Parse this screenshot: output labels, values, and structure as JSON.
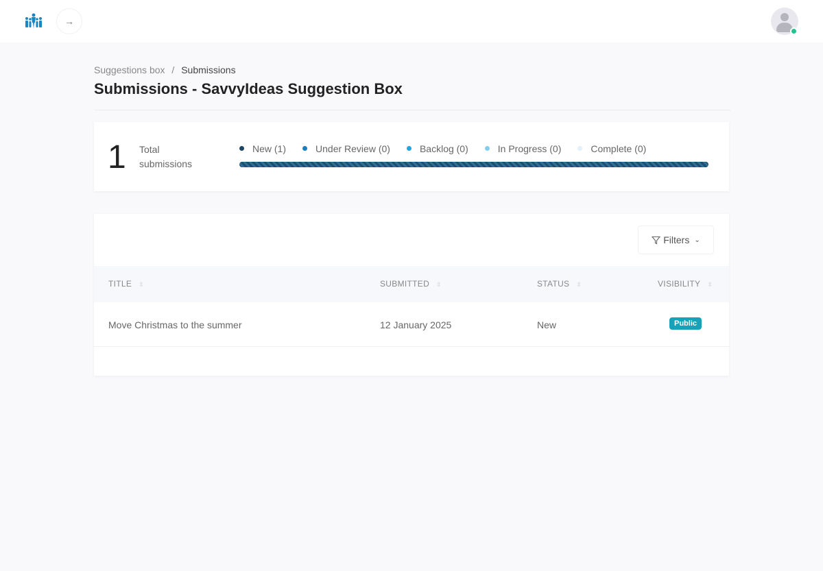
{
  "breadcrumb": {
    "parent": "Suggestions box",
    "separator": "/",
    "current": "Submissions"
  },
  "page_title": "Submissions - SavvyIdeas Suggestion Box",
  "summary": {
    "total": "1",
    "total_label": "Total submissions",
    "progress_new_percent": 100,
    "statuses": [
      {
        "label": "New (1)",
        "color": "#1d4566"
      },
      {
        "label": "Under Review (0)",
        "color": "#1a7fc0"
      },
      {
        "label": "Backlog (0)",
        "color": "#23a6e0"
      },
      {
        "label": "In Progress (0)",
        "color": "#85cdf0"
      },
      {
        "label": "Complete (0)",
        "color": "#e3f0fb"
      }
    ]
  },
  "filters_label": "Filters",
  "table": {
    "columns": [
      "TITLE",
      "SUBMITTED",
      "STATUS",
      "VISIBILITY"
    ],
    "rows": [
      {
        "title": "Move Christmas to the summer",
        "submitted": "12 January 2025",
        "status": "New",
        "visibility": "Public"
      }
    ]
  },
  "icons": {
    "collapse": "→"
  }
}
